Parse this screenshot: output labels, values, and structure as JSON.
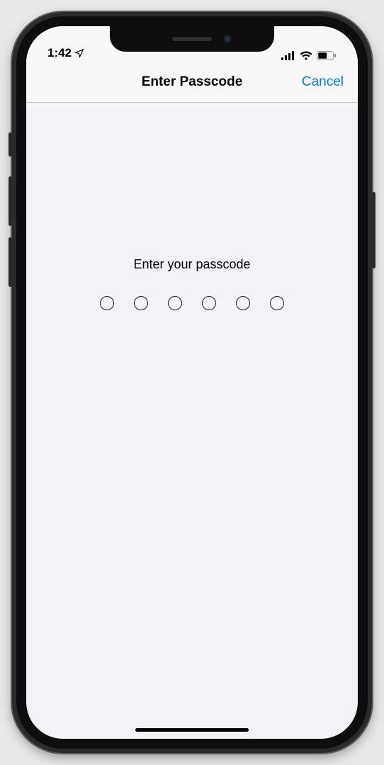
{
  "status": {
    "time": "1:42",
    "location_icon": "location-arrow",
    "signal_bars": 4,
    "wifi": true,
    "battery_level": 55
  },
  "nav": {
    "title": "Enter Passcode",
    "cancel_label": "Cancel"
  },
  "passcode": {
    "prompt": "Enter your passcode",
    "length": 6,
    "entered": 0
  },
  "colors": {
    "accent": "#007aff",
    "background": "#f2f2f7",
    "nav_bg": "#f8f8f8",
    "separator": "#c6c6c8"
  }
}
